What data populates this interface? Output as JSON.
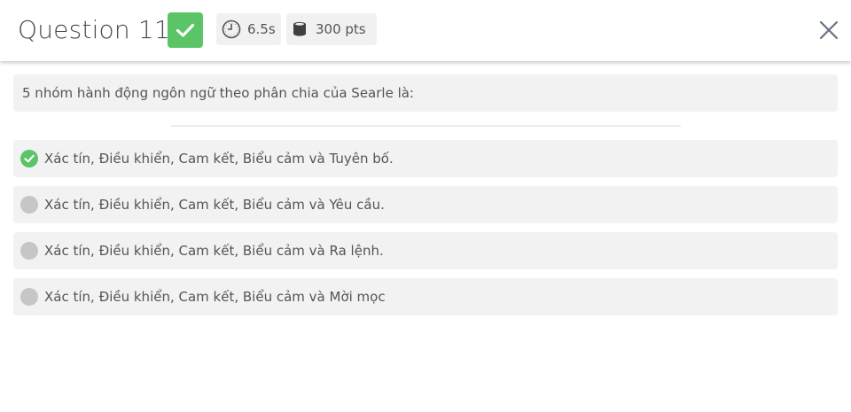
{
  "header": {
    "title": "Question 11",
    "status": "correct",
    "time": "6.5s",
    "points": "300 pts",
    "icons": {
      "status": "check-icon",
      "time": "clock-icon",
      "points": "coins-icon",
      "close": "close-icon"
    }
  },
  "question": {
    "text": "5 nhóm hành động ngôn ngữ theo phân chia của Searle là:"
  },
  "options": [
    {
      "text": "Xác tín, Điều khiển, Cam kết, Biểu cảm và Tuyên bố.",
      "state": "correct"
    },
    {
      "text": "Xác tín, Điều khiển, Cam kết, Biểu cảm và Yêu cầu.",
      "state": "neutral"
    },
    {
      "text": "Xác tín, Điều khiển, Cam kết, Biểu cảm và Ra lệnh.",
      "state": "neutral"
    },
    {
      "text": "Xác tín, Điều khiển, Cam kết, Biểu cảm và Mời mọc",
      "state": "neutral"
    }
  ],
  "colors": {
    "correct": "#5ac467",
    "neutral": "#c6c6c6",
    "panel": "#f2f2f2"
  }
}
